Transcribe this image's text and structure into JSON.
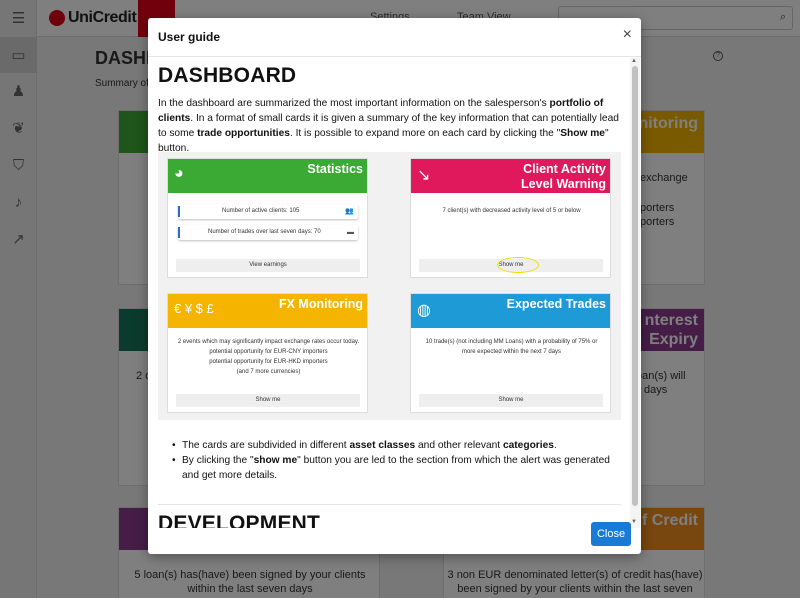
{
  "app": {
    "brand": "UniCredit",
    "menu_settings": "Settings",
    "menu_team": "Team View",
    "search_placeholder": ""
  },
  "background": {
    "page_title": "DASHB",
    "page_subtitle": "Summary of",
    "card_fx_title": "nitoring",
    "card_fx_lines": [
      "exchange",
      "porters",
      "porters"
    ],
    "card_interest_title1": "nterest",
    "card_interest_title2": "Expiry",
    "card_interest_lines": [
      "oan(s) will",
      "days"
    ],
    "card_left_mid_text": "2 c",
    "card_credit_title": "f Credit",
    "card_loans_text1": "5 loan(s) has(have) been signed by your clients",
    "card_loans_text2": "within the last seven days",
    "card_credit_text1": "3 non EUR denominated letter(s) of credit has(have)",
    "card_credit_text2": "been signed by your clients within the last seven"
  },
  "modal": {
    "title": "User guide",
    "close_symbol": "×",
    "close_button": "Close",
    "section_title": "DASHBOARD",
    "intro_1": "In the dashboard are summarized the most important information on the salesperson's ",
    "intro_1b": "portfolio of clients",
    "intro_2": ". In a format of small cards it is given a summary of the key information that can potentially lead to some ",
    "intro_2b": "trade opportunities",
    "intro_3": ". It is possible to expand more on each card by clicking the \"",
    "intro_3b": "Show me",
    "intro_4": "\" button.",
    "bullet_1a": "The cards are subdivided in different ",
    "bullet_1b": "asset classes",
    "bullet_1c": " and other relevant ",
    "bullet_1d": "categories",
    "bullet_1e": ".",
    "bullet_2a": "By clicking the \"",
    "bullet_2b": "show me",
    "bullet_2c": "\" button you are led to the section from which the alert was generated and get more details.",
    "next_section": "DEVELOPMENT"
  },
  "preview": {
    "stats": {
      "title": "Statistics",
      "row1": "Number of active clients: 105",
      "row2": "Number of trades over last seven days: 70",
      "button": "View earnings"
    },
    "activity": {
      "title1": "Client Activity",
      "title2": "Level Warning",
      "text": "7 client(s) with decreased activity level of 5 or below",
      "button": "Show me"
    },
    "fx": {
      "title": "FX Monitoring",
      "icon": "€ ¥ $ £",
      "line1": "2 events which may significantly impact exchange rates occur today.",
      "line2": "potential opportunity for EUR-CNY importers",
      "line3": "potential opportunity for EUR-HKD importers",
      "line4": "(and 7 more currencies)",
      "button": "Show me"
    },
    "expected": {
      "title": "Expected Trades",
      "line1": "10 trade(s) (not including MM Loans) with a probability of 75% or",
      "line2": "more expected within the next 7 days",
      "button": "Show me"
    }
  },
  "colors": {
    "brand_red": "#e2001a",
    "green": "#3aaa35",
    "magenta": "#e0185c",
    "orange": "#f5b400",
    "blue": "#1e9ad6",
    "purple": "#8a3a8f",
    "dark_green": "#17775a",
    "button_blue": "#1a7bd6"
  }
}
